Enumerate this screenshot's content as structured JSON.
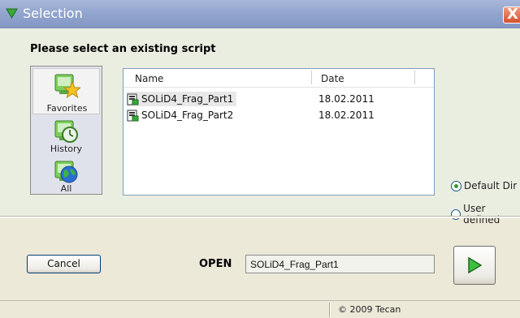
{
  "window": {
    "title": "Selection",
    "close_glyph": "X",
    "title_icon": "green-triangle-down-icon"
  },
  "heading": "Please select an existing script",
  "shortcuts": [
    {
      "label": "Favorites",
      "icon": "favorites-star-icon",
      "active": true
    },
    {
      "label": "History",
      "icon": "history-clock-icon",
      "active": false
    },
    {
      "label": "All",
      "icon": "globe-icon",
      "active": false
    }
  ],
  "file_list": {
    "columns": [
      "Name",
      "Date"
    ],
    "rows": [
      {
        "name": "SOLiD4_Frag_Part1",
        "date": "18.02.2011",
        "selected": true
      },
      {
        "name": "SOLiD4_Frag_Part2",
        "date": "18.02.2011",
        "selected": false
      }
    ]
  },
  "directory_options": [
    {
      "label": "Default Dir",
      "checked": true
    },
    {
      "label": "User defined",
      "checked": false
    }
  ],
  "footer": {
    "cancel_label": "Cancel",
    "open_label": "OPEN",
    "open_value": "SOLiD4_Frag_Part1",
    "go_icon": "play-arrow-icon"
  },
  "status": {
    "copyright": "© 2009 Tecan"
  },
  "colors": {
    "title_bar": "#93a6cf",
    "panel_bg": "#eaeee0",
    "accent_green": "#2f9b2f",
    "close_red": "#d6512c"
  }
}
